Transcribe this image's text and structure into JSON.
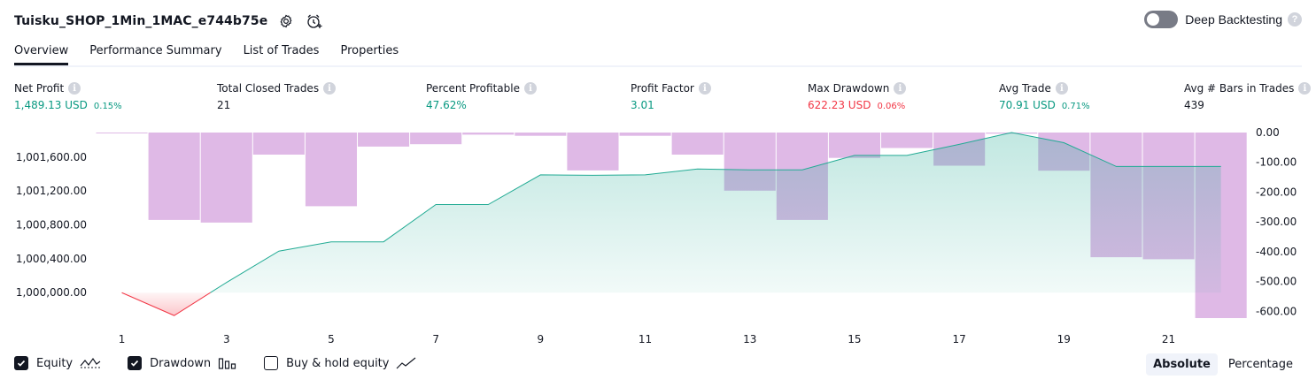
{
  "header": {
    "strategy_title": "Tuisku_SHOP_1Min_1MAC_e744b75e",
    "settings_icon": "gear-icon",
    "alert_icon": "add-alert-clock-icon",
    "deep_backtesting_label": "Deep Backtesting",
    "deep_backtesting_enabled": false
  },
  "tabs": [
    {
      "label": "Overview",
      "active": true
    },
    {
      "label": "Performance Summary",
      "active": false
    },
    {
      "label": "List of Trades",
      "active": false
    },
    {
      "label": "Properties",
      "active": false
    }
  ],
  "metrics": [
    {
      "label": "Net Profit",
      "value": "1,489.13 USD",
      "sub": "0.15%",
      "color": "#089981"
    },
    {
      "label": "Total Closed Trades",
      "value": "21",
      "sub": "",
      "color": "#131722"
    },
    {
      "label": "Percent Profitable",
      "value": "47.62%",
      "sub": "",
      "color": "#089981"
    },
    {
      "label": "Profit Factor",
      "value": "3.01",
      "sub": "",
      "color": "#089981"
    },
    {
      "label": "Max Drawdown",
      "value": "622.23 USD",
      "sub": "0.06%",
      "color": "#f23645"
    },
    {
      "label": "Avg Trade",
      "value": "70.91 USD",
      "sub": "0.71%",
      "color": "#089981"
    },
    {
      "label": "Avg # Bars in Trades",
      "value": "439",
      "sub": "",
      "color": "#131722"
    }
  ],
  "chart_data": {
    "type": "area",
    "x_ticks": [
      "1",
      "3",
      "5",
      "7",
      "9",
      "11",
      "13",
      "15",
      "17",
      "19",
      "21"
    ],
    "left_axis": {
      "ticks": [
        "1,000,000.00",
        "1,000,400.00",
        "1,000,800.00",
        "1,001,200.00",
        "1,001,600.00"
      ],
      "ylim": [
        999700,
        1001890
      ]
    },
    "right_axis": {
      "ticks": [
        "0.00",
        "-100.00",
        "-200.00",
        "-300.00",
        "-400.00",
        "-500.00",
        "-600.00"
      ],
      "ylim": [
        -622.23,
        0
      ]
    },
    "baseline": 1000000,
    "equity": {
      "x": [
        1,
        2,
        3,
        4,
        5,
        6,
        7,
        8,
        9,
        10,
        11,
        12,
        13,
        14,
        15,
        16,
        17,
        18,
        19,
        20,
        21,
        22
      ],
      "values": [
        1000000,
        999730,
        1000120,
        1000490,
        1000600,
        1000600,
        1001040,
        1001040,
        1001390,
        1001385,
        1001390,
        1001460,
        1001450,
        1001450,
        1001620,
        1001620,
        1001750,
        1001890,
        1001770,
        1001490,
        1001490,
        1001490
      ]
    },
    "drawdown": {
      "x": [
        1,
        2,
        3,
        4,
        5,
        6,
        7,
        8,
        9,
        10,
        11,
        12,
        13,
        14,
        15,
        16,
        17,
        18,
        19,
        20,
        21,
        22
      ],
      "values": [
        -3,
        -293,
        -302,
        -74,
        -247,
        -47,
        -39,
        -7,
        -11,
        -127,
        -11,
        -74,
        -195,
        -293,
        -85,
        -52,
        -111,
        -4,
        -128,
        -418,
        -425,
        -622.23
      ]
    },
    "colors": {
      "equity_line": "#22ab94",
      "equity_fill": "#22ab94",
      "loss_line": "#f23645",
      "drawdown": "#ce93d8",
      "overlap": "#b2b5be"
    }
  },
  "legend": [
    {
      "label": "Equity",
      "checked": true,
      "icon": "equity-line-icon"
    },
    {
      "label": "Drawdown",
      "checked": true,
      "icon": "drawdown-bars-icon"
    },
    {
      "label": "Buy & hold equity",
      "checked": false,
      "icon": "buy-hold-line-icon"
    }
  ],
  "mode": {
    "absolute_label": "Absolute",
    "percentage_label": "Percentage",
    "selected": "Absolute"
  }
}
